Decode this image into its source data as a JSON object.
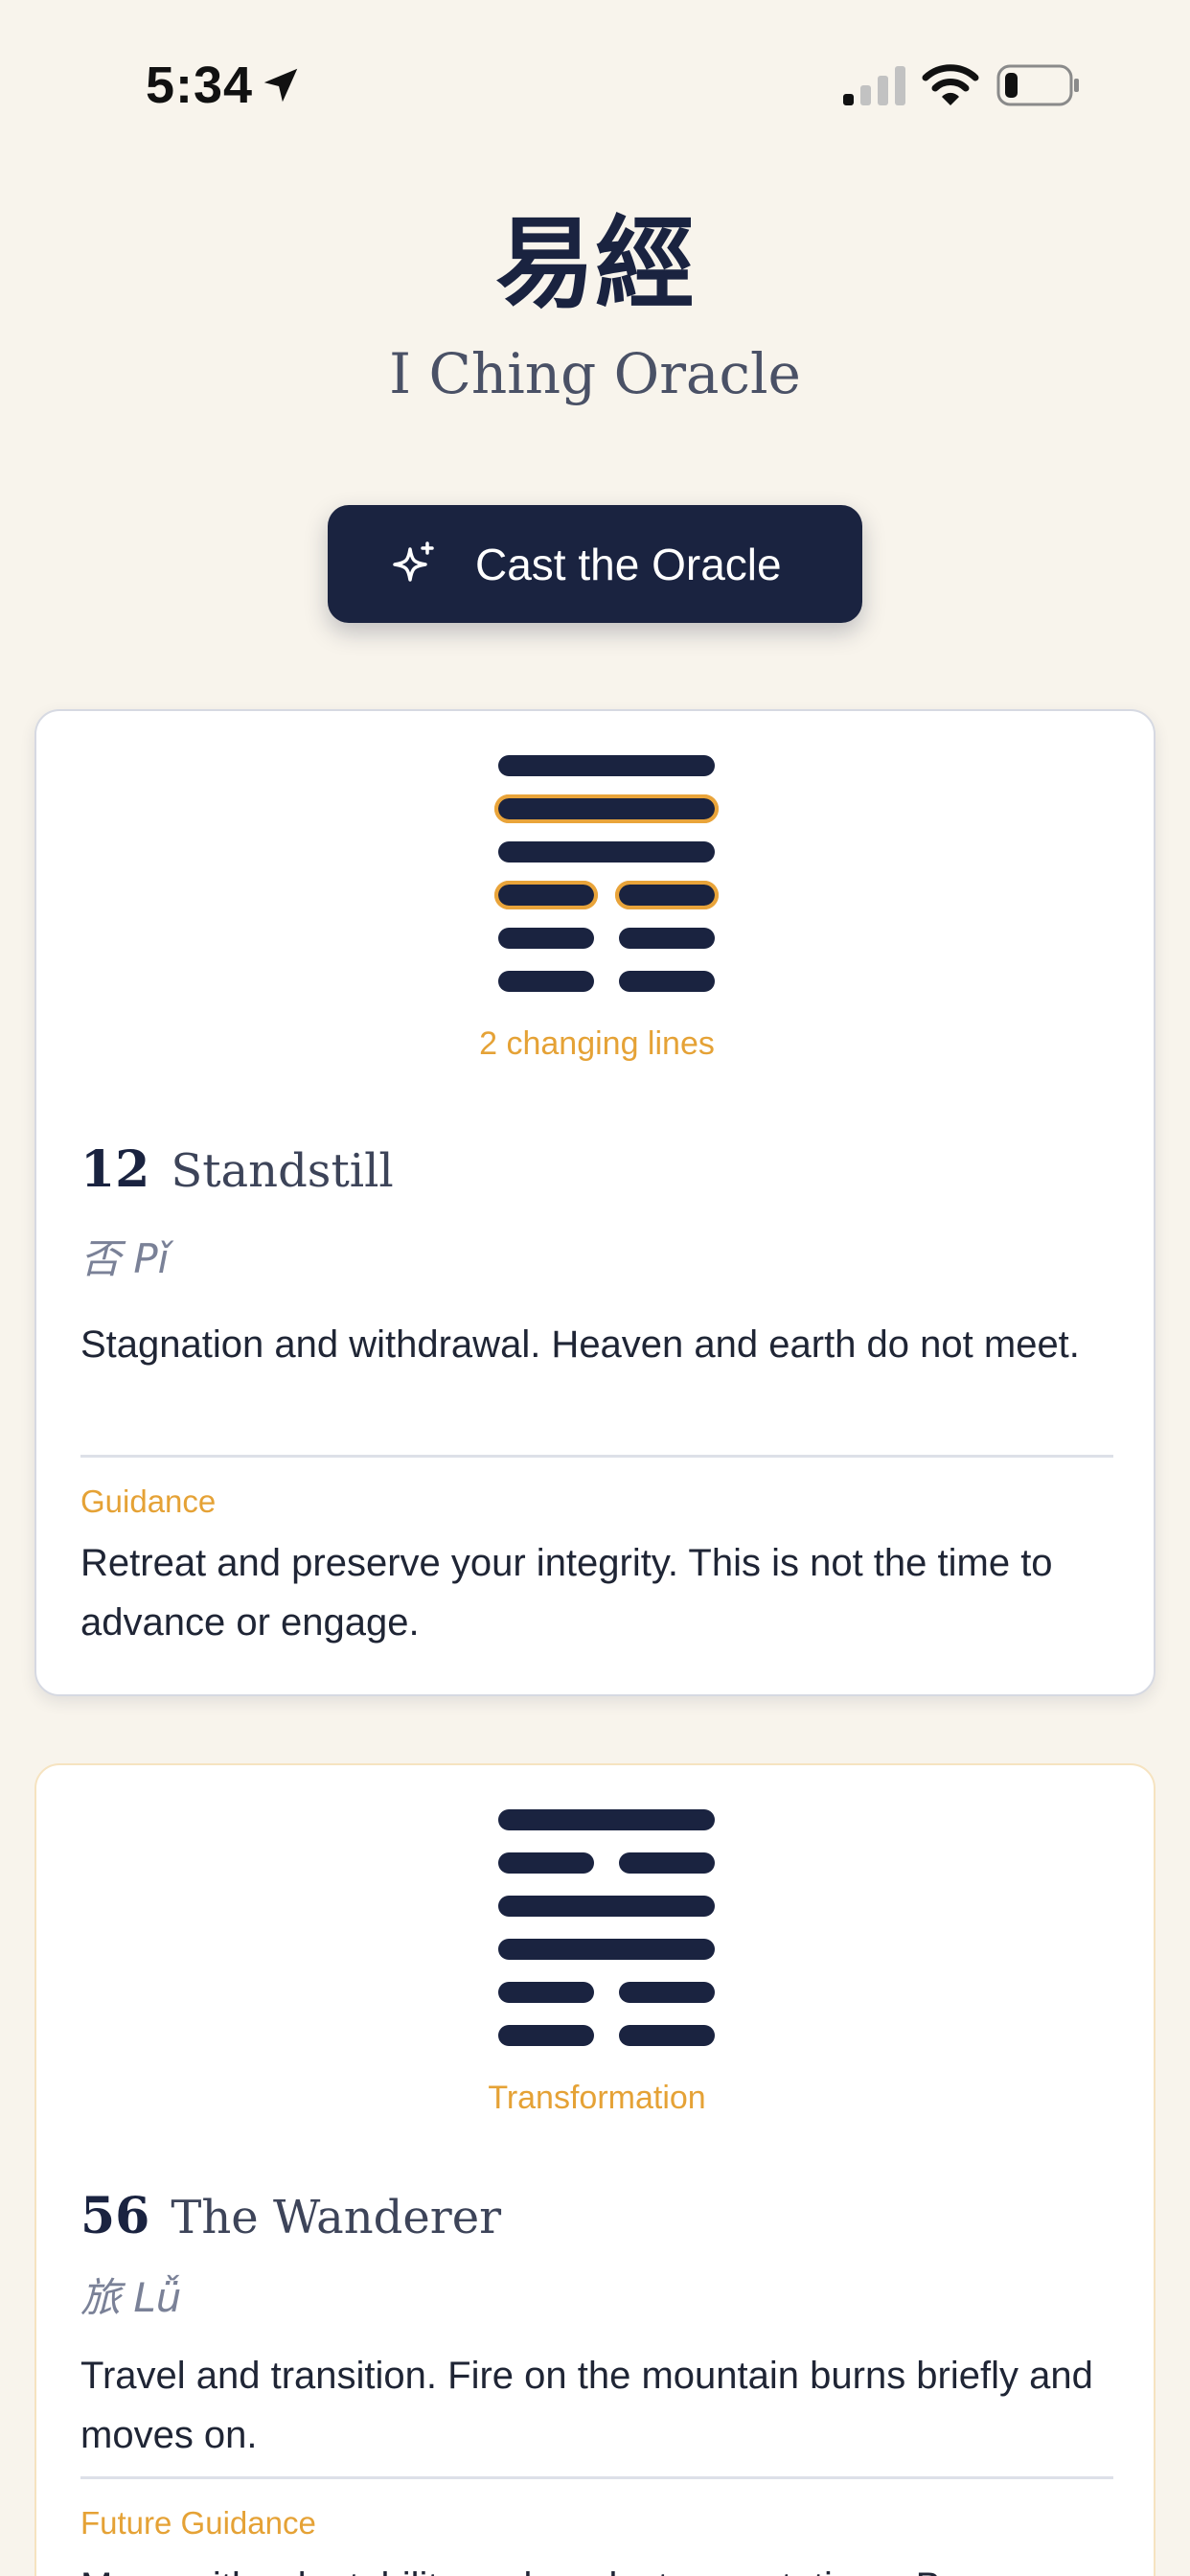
{
  "status": {
    "time": "5:34"
  },
  "header": {
    "title": "易經",
    "subtitle": "I Ching Oracle"
  },
  "cast_button": {
    "label": "Cast the Oracle"
  },
  "primary": {
    "caption": "2 changing lines",
    "number": "12",
    "name": "Standstill",
    "chinese": "否 Pǐ",
    "description": "Stagnation and withdrawal. Heaven and earth do not meet.",
    "guidance_label": "Guidance",
    "guidance": "Retreat and preserve your integrity. This is not the time to advance or engage."
  },
  "future": {
    "caption": "Transformation",
    "number": "56",
    "name": "The Wanderer",
    "chinese": "旅 Lǚ",
    "description": "Travel and transition. Fire on the mountain burns briefly and moves on.",
    "guidance_label": "Future Guidance",
    "guidance": "Move with adaptability and modest expectations. Be"
  },
  "colors": {
    "background": "#f8f4ec",
    "navy": "#1a2340",
    "accent": "#e5a236"
  }
}
